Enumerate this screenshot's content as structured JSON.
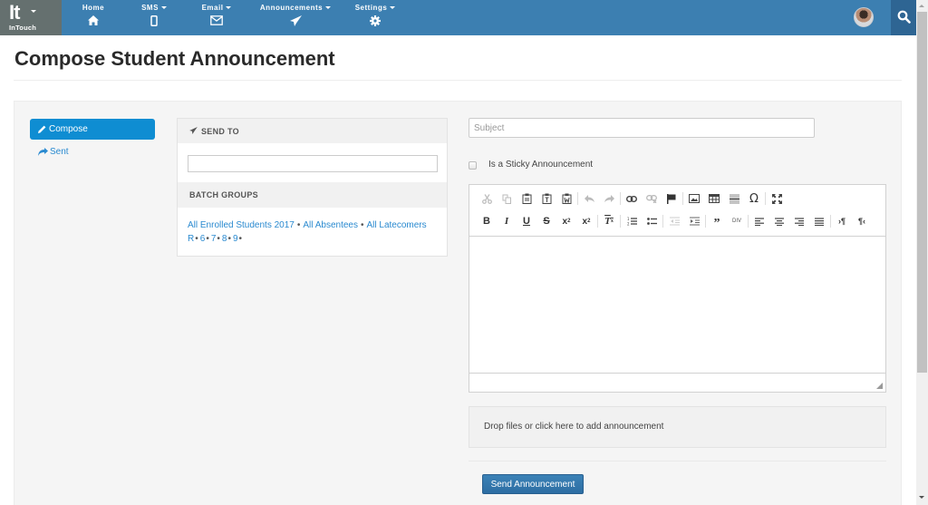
{
  "app": {
    "logo_text": "It",
    "brand_name": "InTouch"
  },
  "nav": [
    {
      "label": "Home",
      "icon": "home-icon",
      "has_dropdown": false
    },
    {
      "label": "SMS",
      "icon": "mobile-icon",
      "has_dropdown": true
    },
    {
      "label": "Email",
      "icon": "envelope-icon",
      "has_dropdown": true
    },
    {
      "label": "Announcements",
      "icon": "paper-plane-icon",
      "has_dropdown": true
    },
    {
      "label": "Settings",
      "icon": "gear-icon",
      "has_dropdown": true
    }
  ],
  "header": {
    "avatar": "user-avatar",
    "search_icon": "search-icon"
  },
  "page": {
    "title": "Compose Student Announcement"
  },
  "sidebar": {
    "items": [
      {
        "label": "Compose",
        "icon": "pencil-icon",
        "active": true
      },
      {
        "label": "Sent",
        "icon": "share-icon",
        "active": false
      }
    ]
  },
  "send_to": {
    "header": "SEND TO",
    "input_value": "",
    "batch_groups_header": "BATCH GROUPS",
    "groups_line1": [
      "All Enrolled Students 2017",
      "All Absentees",
      "All Latecomers"
    ],
    "groups_line2": [
      "R",
      "6",
      "7",
      "8",
      "9"
    ],
    "separator": "•"
  },
  "compose": {
    "subject_placeholder": "Subject",
    "subject_value": "",
    "sticky_label": "Is a Sticky Announcement",
    "sticky_checked": false,
    "toolbar_row1": [
      "cut",
      "copy",
      "paste",
      "paste-text",
      "paste-from-word",
      "|",
      "undo",
      "redo",
      "|",
      "link",
      "unlink",
      "anchor",
      "|",
      "image",
      "table",
      "horizontal-line",
      "special-char",
      "|",
      "maximize"
    ],
    "toolbar_row2": [
      "bold",
      "italic",
      "underline",
      "strikethrough",
      "subscript",
      "superscript",
      "|",
      "remove-format",
      "|",
      "numbered-list",
      "bulleted-list",
      "|",
      "outdent",
      "indent",
      "|",
      "blockquote",
      "create-div",
      "|",
      "align-left",
      "align-center",
      "align-right",
      "justify",
      "|",
      "text-direction-ltr",
      "text-direction-rtl"
    ],
    "body": "",
    "dropzone_text": "Drop files or click here to add announcement",
    "send_button": "Send Announcement"
  },
  "colors": {
    "topbar": "#3c7fb1",
    "brand_bg": "#65706f",
    "search_bg": "#2e6593",
    "active_nav": "#0f8dd2",
    "link": "#2a8ad0",
    "send_button": "#3476ac"
  }
}
